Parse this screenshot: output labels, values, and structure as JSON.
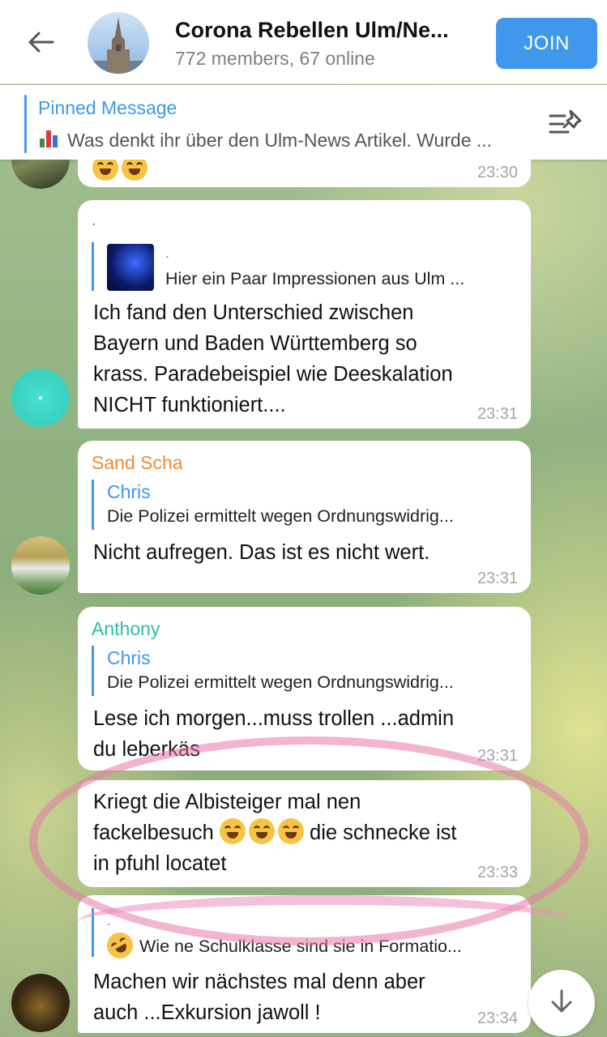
{
  "header": {
    "title": "Corona Rebellen Ulm/Ne...",
    "subtitle": "772 members, 67 online",
    "join_label": "JOIN"
  },
  "pinned": {
    "title": "Pinned Message",
    "text": "Was denkt ihr über den Ulm-News Artikel. Wurde ..."
  },
  "messages": [
    {
      "time": "23:30"
    },
    {
      "sender": ".",
      "reply_name": ".",
      "reply_text": "Hier ein Paar Impressionen aus Ulm ...",
      "text_lines": [
        "Ich fand den Unterschied zwischen",
        "Bayern und Baden Württemberg so",
        "krass. Paradebeispiel wie Deeskalation",
        "NICHT funktioniert...."
      ],
      "time": "23:31"
    },
    {
      "sender": "Sand Scha",
      "reply_name": "Chris",
      "reply_text": "Die Polizei ermittelt wegen Ordnungswidrig...",
      "text": "Nicht aufregen. Das ist es nicht wert.",
      "time": "23:31"
    },
    {
      "sender": "Anthony",
      "reply_name": "Chris",
      "reply_text": "Die Polizei ermittelt wegen Ordnungswidrig...",
      "text_lines": [
        "Lese ich morgen...muss trollen ...admin",
        "du leberkäs"
      ],
      "time": "23:31"
    },
    {
      "line1": "Kriegt die Albisteiger mal nen",
      "line2_a": "fackelbesuch",
      "line2_b": "die schnecke ist",
      "line3": "in pfuhl locatet",
      "time": "23:33"
    },
    {
      "reply_name": ".",
      "reply_text": "Wie ne Schulklasse sind sie in Formatio...",
      "text_lines": [
        "Machen wir nächstes mal denn aber",
        "auch ...Exkursion jawoll !"
      ],
      "time": "23:34"
    }
  ],
  "colors": {
    "accent": "#3f98ec",
    "sender_sand": "#f08a3a",
    "sender_anthony": "#2dbfa6"
  }
}
